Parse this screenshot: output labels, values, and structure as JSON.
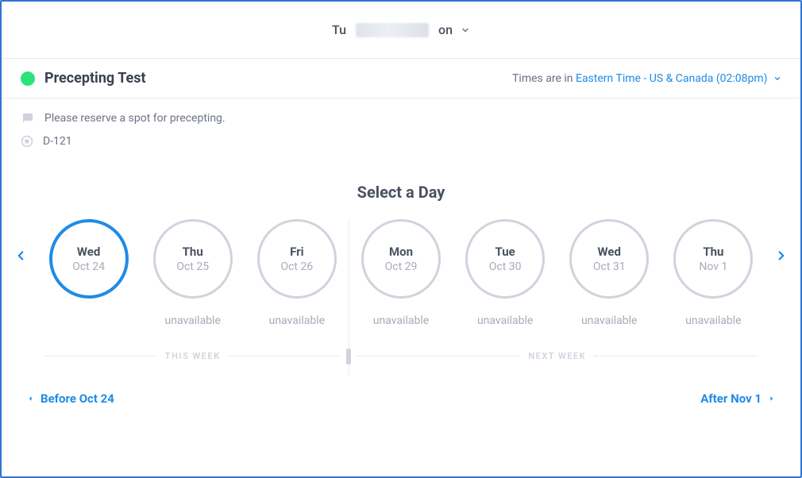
{
  "header": {
    "user_prefix": "Tu",
    "user_suffix": "on"
  },
  "subheader": {
    "indicator_color": "#2be27a",
    "title": "Precepting Test",
    "times_prefix": "Times are in ",
    "timezone": "Eastern Time - US & Canada (02:08pm)"
  },
  "details": {
    "instruction": "Please reserve a spot for precepting.",
    "location": "D-121"
  },
  "select": {
    "heading": "Select a Day",
    "this_week_label": "THIS WEEK",
    "next_week_label": "NEXT WEEK",
    "unavailable_label": "unavailable",
    "days": [
      {
        "dow": "Wed",
        "date": "Oct 24",
        "available": true
      },
      {
        "dow": "Thu",
        "date": "Oct 25",
        "available": false
      },
      {
        "dow": "Fri",
        "date": "Oct 26",
        "available": false
      },
      {
        "dow": "Mon",
        "date": "Oct 29",
        "available": false
      },
      {
        "dow": "Tue",
        "date": "Oct 30",
        "available": false
      },
      {
        "dow": "Wed",
        "date": "Oct 31",
        "available": false
      },
      {
        "dow": "Thu",
        "date": "Nov 1",
        "available": false
      }
    ]
  },
  "nav": {
    "before": "Before Oct 24",
    "after": "After Nov 1"
  },
  "colors": {
    "primary": "#1f8be6",
    "muted": "#a6abba",
    "border": "#cfd3dc"
  }
}
